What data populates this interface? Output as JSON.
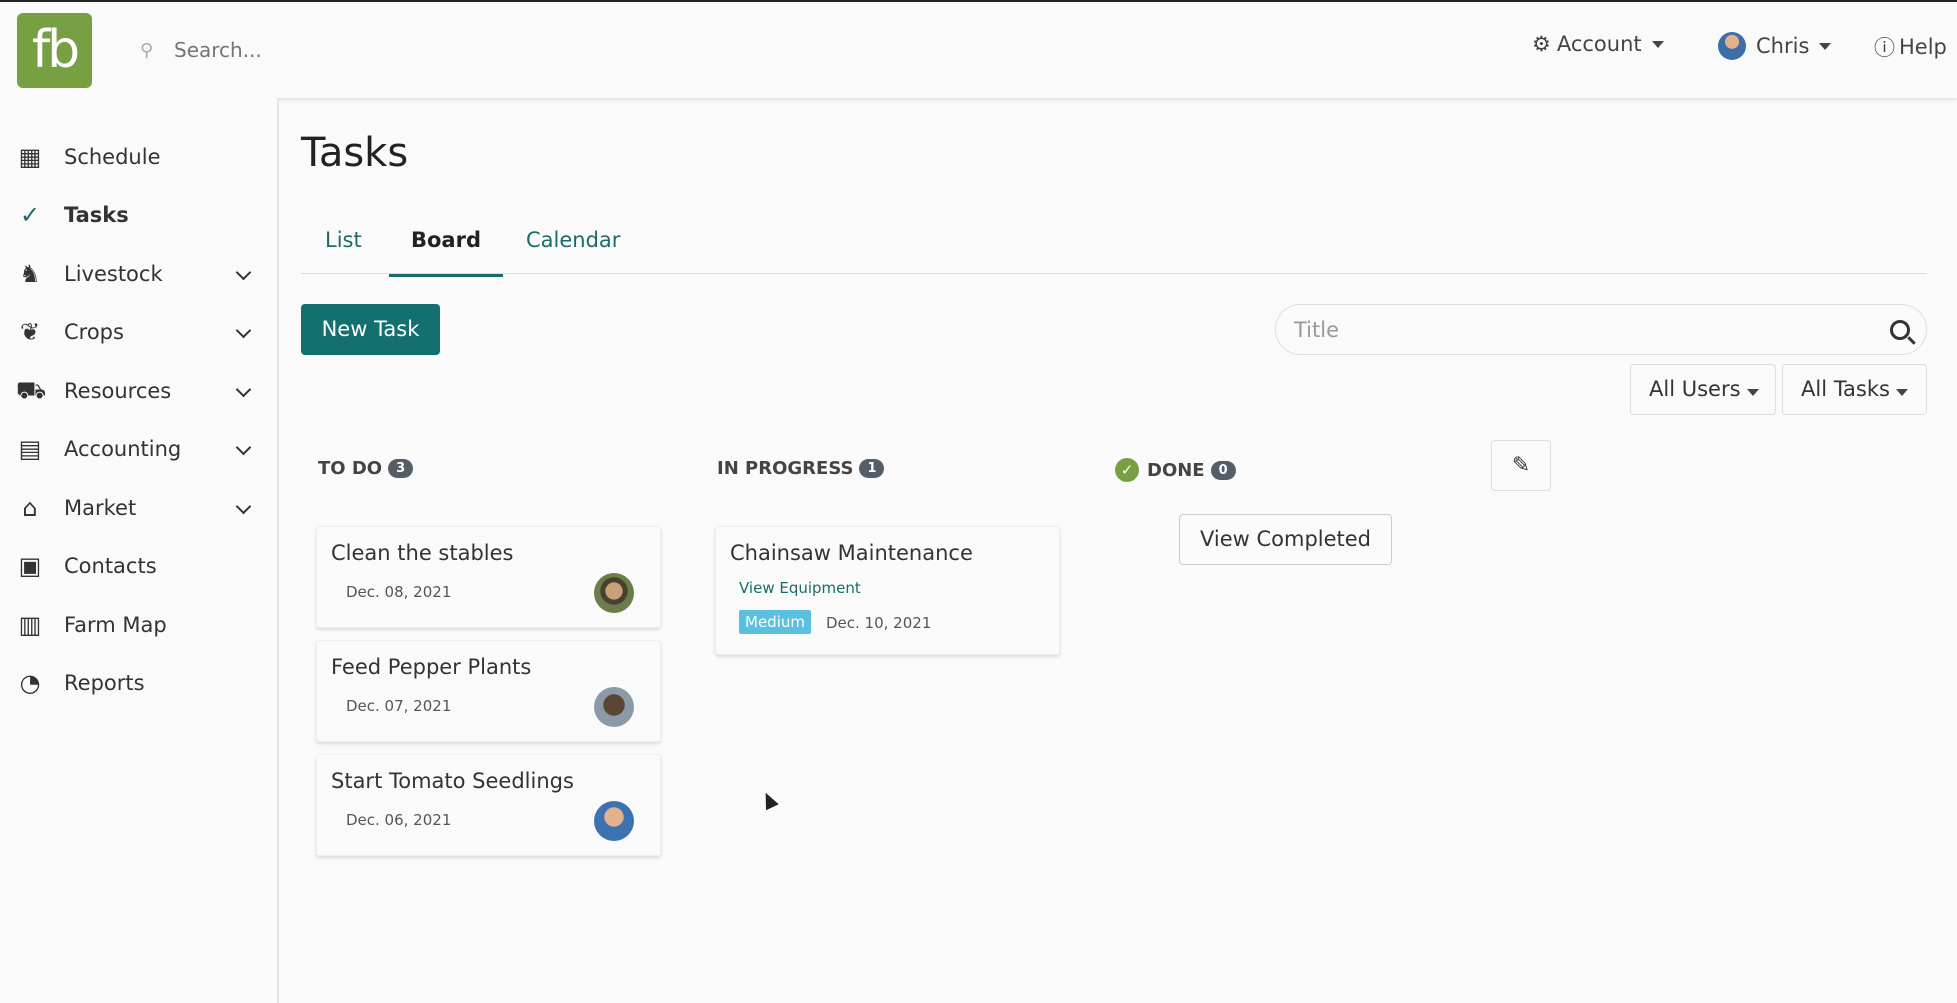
{
  "header": {
    "logo_text": "fb",
    "search_placeholder": "Search...",
    "account_label": "Account",
    "user_label": "Chris",
    "help_label": "Help"
  },
  "sidebar": {
    "items": [
      {
        "label": "Schedule",
        "icon": "calendar-icon"
      },
      {
        "label": "Tasks",
        "icon": "check-circle-icon",
        "active": true
      },
      {
        "label": "Livestock",
        "icon": "horse-icon",
        "expandable": true
      },
      {
        "label": "Crops",
        "icon": "seedling-icon",
        "expandable": true
      },
      {
        "label": "Resources",
        "icon": "tractor-icon",
        "expandable": true
      },
      {
        "label": "Accounting",
        "icon": "calculator-icon",
        "expandable": true
      },
      {
        "label": "Market",
        "icon": "store-icon",
        "expandable": true
      },
      {
        "label": "Contacts",
        "icon": "contact-book-icon"
      },
      {
        "label": "Farm Map",
        "icon": "map-icon"
      },
      {
        "label": "Reports",
        "icon": "pie-chart-icon"
      }
    ]
  },
  "main": {
    "title": "Tasks",
    "tabs": [
      "List",
      "Board",
      "Calendar"
    ],
    "active_tab": "Board",
    "new_task_label": "New Task",
    "title_search_placeholder": "Title",
    "filter_users": "All Users",
    "filter_tasks": "All Tasks"
  },
  "board": {
    "todo": {
      "label": "TO DO",
      "count": "3"
    },
    "in_progress": {
      "label": "IN PROGRESS",
      "count": "1"
    },
    "done": {
      "label": "DONE",
      "count": "0"
    },
    "view_completed_label": "View Completed",
    "todo_cards": [
      {
        "title": "Clean the stables",
        "date": "Dec. 08, 2021"
      },
      {
        "title": "Feed Pepper Plants",
        "date": "Dec. 07, 2021"
      },
      {
        "title": "Start Tomato Seedlings",
        "date": "Dec. 06, 2021"
      }
    ],
    "progress_cards": [
      {
        "title": "Chainsaw Maintenance",
        "link": "View Equipment",
        "priority": "Medium",
        "date": "Dec. 10, 2021"
      }
    ]
  },
  "colors": {
    "brand_green": "#77a043",
    "primary_teal": "#13706e",
    "priority_medium": "#5bc0de"
  }
}
